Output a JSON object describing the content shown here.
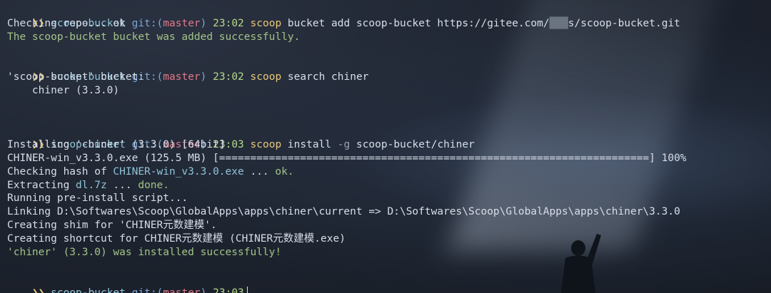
{
  "prompt": {
    "arrow": "❯❯",
    "dir": "scoop-bucket",
    "git_prefix": "git:(",
    "branch": "master",
    "git_suffix": ")"
  },
  "blocks": [
    {
      "time": "23:02",
      "cmd": "scoop",
      "args": " bucket add scoop-bucket https://gitee.com/",
      "args_redacted": "███",
      "args_tail": "s/scoop-bucket.git",
      "output": [
        {
          "text": "Checking repo... ok",
          "color": "default"
        },
        {
          "text": "The scoop-bucket bucket was added successfully.",
          "color": "green"
        }
      ]
    },
    {
      "time": "23:02",
      "cmd": "scoop",
      "args": " search chiner",
      "output": [
        {
          "text": "'scoop-bucket' bucket:",
          "color": "default"
        },
        {
          "text": "    chiner (3.3.0)",
          "color": "default"
        }
      ]
    },
    {
      "time": "23:03",
      "cmd": "scoop",
      "args": " install ",
      "flag": "-g",
      "args_tail": " scoop-bucket/chiner",
      "output": [
        {
          "text": "Installing 'chiner' (3.3.0) [64bit]"
        },
        {
          "text": "CHINER-win_v3.3.0.exe (125.5 MB) [=====================================================================] 100%"
        },
        {
          "pre": "Checking hash of ",
          "hl": "CHINER-win_v3.3.0.exe",
          "post": " ... ",
          "ok": "ok."
        },
        {
          "pre": "Extracting ",
          "hl": "dl.7z",
          "post": " ... ",
          "ok": "done."
        },
        {
          "text": "Running pre-install script..."
        },
        {
          "text": "Linking D:\\Softwares\\Scoop\\GlobalApps\\apps\\chiner\\current => D:\\Softwares\\Scoop\\GlobalApps\\apps\\chiner\\3.3.0"
        },
        {
          "text": "Creating shim for 'CHINER元数建模'."
        },
        {
          "text": "Creating shortcut for CHINER元数建模 (CHINER元数建模.exe)"
        },
        {
          "text": "'chiner' (3.3.0) was installed successfully!",
          "color": "green"
        }
      ]
    },
    {
      "time": "23:03"
    }
  ],
  "colors": {
    "background": "#1e2430",
    "arrow": "#e8c77a",
    "dir": "#8fc4d8",
    "branch": "#e07a8a",
    "time": "#b6d98a",
    "success": "#a3c488"
  }
}
